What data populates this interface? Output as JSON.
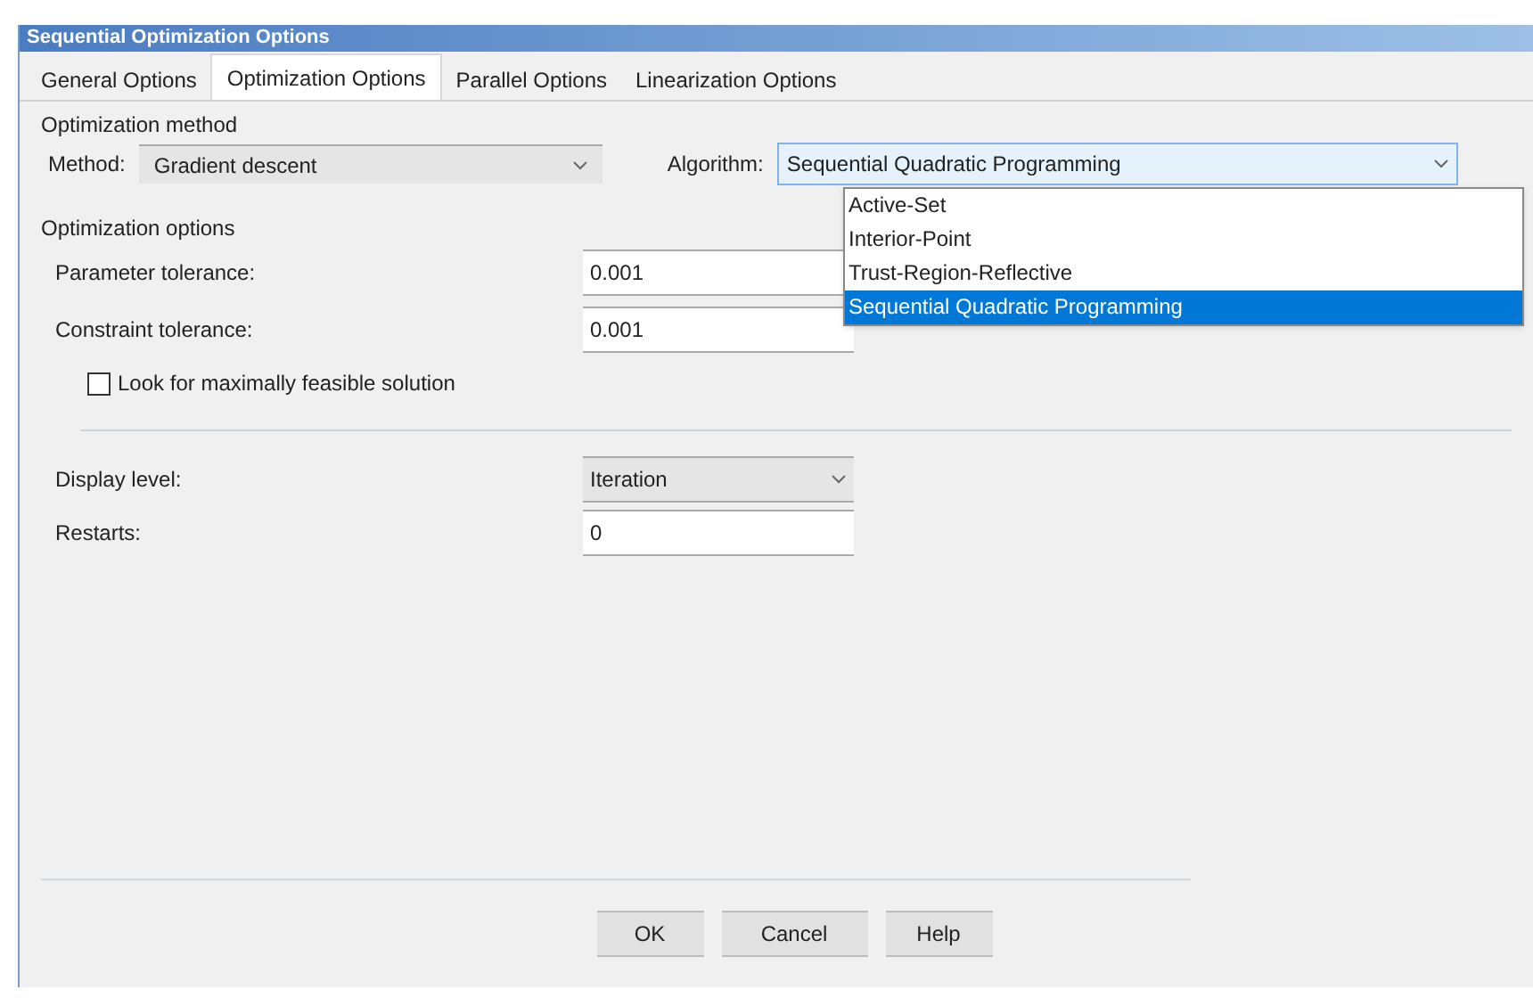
{
  "window": {
    "title": "Sequential Optimization Options"
  },
  "tabs": [
    {
      "label": "General Options",
      "selected": false
    },
    {
      "label": "Optimization Options",
      "selected": true
    },
    {
      "label": "Parallel Options",
      "selected": false
    },
    {
      "label": "Linearization Options",
      "selected": false
    }
  ],
  "method_group": {
    "title": "Optimization method",
    "method_label": "Method:",
    "method_value": "Gradient descent",
    "algorithm_label": "Algorithm:",
    "algorithm_value": "Sequential Quadratic Programming",
    "algorithm_options": [
      {
        "label": "Active-Set",
        "selected": false
      },
      {
        "label": "Interior-Point",
        "selected": false
      },
      {
        "label": "Trust-Region-Reflective",
        "selected": false
      },
      {
        "label": "Sequential Quadratic Programming",
        "selected": true
      }
    ]
  },
  "options_group": {
    "title": "Optimization options",
    "fields": [
      {
        "label": "Parameter tolerance:",
        "value": "0.001"
      },
      {
        "label": "Constraint tolerance:",
        "value": "0.001"
      }
    ],
    "checkbox": {
      "label": "Look for maximally feasible solution",
      "checked": false
    }
  },
  "display_level": {
    "label": "Display level:",
    "value": "Iteration"
  },
  "restarts": {
    "label": "Restarts:",
    "value": "0"
  },
  "buttons": [
    "OK",
    "Cancel",
    "Help"
  ]
}
